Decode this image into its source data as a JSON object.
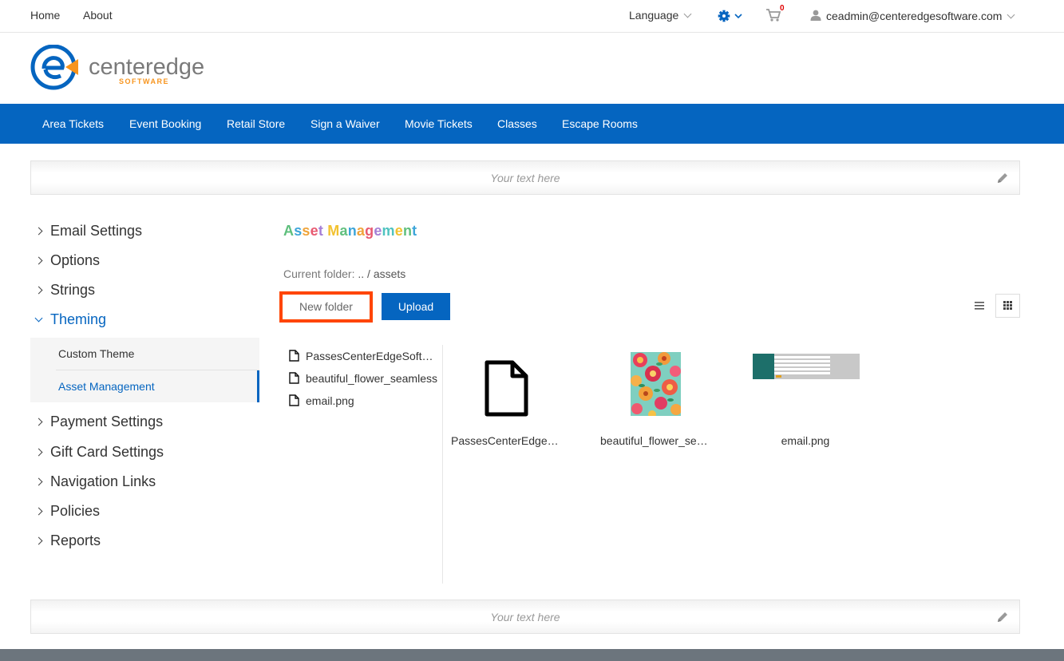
{
  "topbar": {
    "home": "Home",
    "about": "About",
    "language": "Language",
    "cart_count": "0",
    "user_email": "ceadmin@centeredgesoftware.com"
  },
  "logo": {
    "name": "centeredge",
    "sub": "SOFTWARE",
    "colors": {
      "blue": "#0565c0",
      "orange": "#f7941d",
      "gray": "#7a7a7a"
    }
  },
  "mainnav": {
    "items": [
      "Area Tickets",
      "Event Booking",
      "Retail Store",
      "Sign a Waiver",
      "Movie Tickets",
      "Classes",
      "Escape Rooms"
    ]
  },
  "banners": {
    "top_text": "Your text here",
    "bottom_text": "Your text here"
  },
  "sidebar": {
    "items": [
      "Email Settings",
      "Options",
      "Strings",
      "Theming",
      "Payment Settings",
      "Gift Card Settings",
      "Navigation Links",
      "Policies",
      "Reports"
    ],
    "open_item": "Theming",
    "sub_items": [
      "Custom Theme",
      "Asset Management"
    ],
    "active_sub": "Asset Management"
  },
  "main": {
    "title": "Asset Management",
    "current_folder_label": "Current folder:",
    "current_folder_path": ".. / assets",
    "new_folder_label": "New folder",
    "upload_label": "Upload",
    "tree_files": [
      "PassesCenterEdgeSoftware",
      "beautiful_flower_seamless",
      "email.png"
    ],
    "tiles": [
      {
        "label": "PassesCenterEdgeSoftware",
        "icon": "file-icon"
      },
      {
        "label": "beautiful_flower_seamless",
        "icon": "image-thumbnail"
      },
      {
        "label": "email.png",
        "icon": "image-thumbnail"
      }
    ]
  },
  "colors": {
    "brand_blue": "#0565c0",
    "highlight_orange": "#ff4500",
    "footer": "#6c757d"
  }
}
